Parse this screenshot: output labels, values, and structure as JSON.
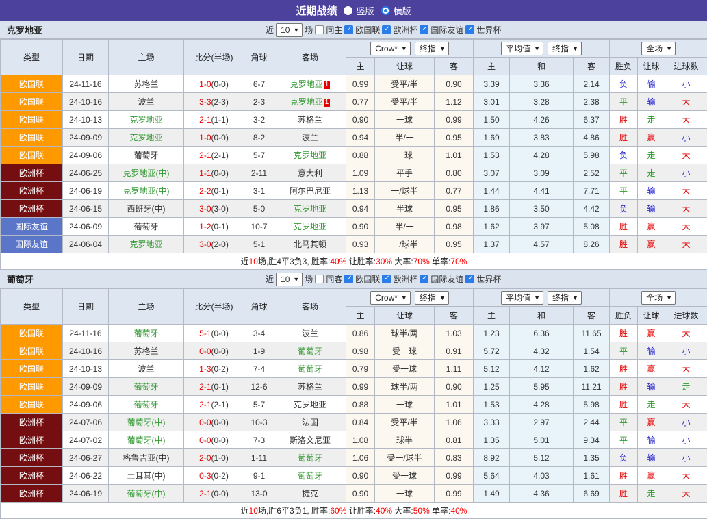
{
  "titlebar": {
    "title": "近期战绩",
    "radios": [
      {
        "label": "竖版",
        "selected": false
      },
      {
        "label": "横版",
        "selected": true
      }
    ]
  },
  "filter": {
    "near": "近",
    "count": "10",
    "field": "场",
    "comps": [
      "欧国联",
      "欧洲杯",
      "国际友谊",
      "世界杯"
    ]
  },
  "table": {
    "main_headers": [
      "类型",
      "日期",
      "主场",
      "比分(半场)",
      "角球",
      "客场"
    ],
    "dropdowns": {
      "source": "Crow*",
      "final_a": "终指",
      "average": "平均值",
      "final_b": "终指",
      "scope": "全场"
    },
    "sub_headers": [
      "主",
      "让球",
      "客",
      "主",
      "和",
      "客",
      "胜负",
      "让球",
      "进球数"
    ]
  },
  "colors": {
    "type_bg": {
      "欧国联": "#ff9900",
      "欧洲杯": "#740e11",
      "国际友谊": "#5b76c8"
    },
    "result": {
      "胜": "red",
      "平": "green",
      "负": "blue",
      "赢": "red",
      "走": "green",
      "输": "blue",
      "大": "red",
      "小": "blue"
    }
  },
  "sections": [
    {
      "team": "克罗地亚",
      "same_toggle": "同主",
      "rows": [
        {
          "type": "欧国联",
          "date": "24-11-16",
          "home": "苏格兰",
          "home_self": false,
          "score": "1-0",
          "half": "(0-0)",
          "corner": "6-7",
          "away": "克罗地亚",
          "away_self": true,
          "away_mark": "1",
          "odds": [
            "0.99",
            "受平/半",
            "0.90"
          ],
          "avg": [
            "3.39",
            "3.36",
            "2.14"
          ],
          "result": [
            "负",
            "输",
            "小"
          ]
        },
        {
          "type": "欧国联",
          "date": "24-10-16",
          "home": "波兰",
          "home_self": false,
          "score": "3-3",
          "half": "(2-3)",
          "corner": "2-3",
          "away": "克罗地亚",
          "away_self": true,
          "away_mark": "1",
          "odds": [
            "0.77",
            "受平/半",
            "1.12"
          ],
          "avg": [
            "3.01",
            "3.28",
            "2.38"
          ],
          "result": [
            "平",
            "输",
            "大"
          ]
        },
        {
          "type": "欧国联",
          "date": "24-10-13",
          "home": "克罗地亚",
          "home_self": true,
          "score": "2-1",
          "half": "(1-1)",
          "corner": "3-2",
          "away": "苏格兰",
          "away_self": false,
          "odds": [
            "0.90",
            "一球",
            "0.99"
          ],
          "avg": [
            "1.50",
            "4.26",
            "6.37"
          ],
          "result": [
            "胜",
            "走",
            "大"
          ]
        },
        {
          "type": "欧国联",
          "date": "24-09-09",
          "home": "克罗地亚",
          "home_self": true,
          "score": "1-0",
          "half": "(0-0)",
          "corner": "8-2",
          "away": "波兰",
          "away_self": false,
          "odds": [
            "0.94",
            "半/一",
            "0.95"
          ],
          "avg": [
            "1.69",
            "3.83",
            "4.86"
          ],
          "result": [
            "胜",
            "赢",
            "小"
          ]
        },
        {
          "type": "欧国联",
          "date": "24-09-06",
          "home": "葡萄牙",
          "home_self": false,
          "score": "2-1",
          "half": "(2-1)",
          "corner": "5-7",
          "away": "克罗地亚",
          "away_self": true,
          "odds": [
            "0.88",
            "一球",
            "1.01"
          ],
          "avg": [
            "1.53",
            "4.28",
            "5.98"
          ],
          "result": [
            "负",
            "走",
            "大"
          ]
        },
        {
          "type": "欧洲杯",
          "date": "24-06-25",
          "home": "克罗地亚(中)",
          "home_self": true,
          "score": "1-1",
          "half": "(0-0)",
          "corner": "2-11",
          "away": "意大利",
          "away_self": false,
          "odds": [
            "1.09",
            "平手",
            "0.80"
          ],
          "avg": [
            "3.07",
            "3.09",
            "2.52"
          ],
          "result": [
            "平",
            "走",
            "小"
          ]
        },
        {
          "type": "欧洲杯",
          "date": "24-06-19",
          "home": "克罗地亚(中)",
          "home_self": true,
          "score": "2-2",
          "half": "(0-1)",
          "corner": "3-1",
          "away": "阿尔巴尼亚",
          "away_self": false,
          "odds": [
            "1.13",
            "一/球半",
            "0.77"
          ],
          "avg": [
            "1.44",
            "4.41",
            "7.71"
          ],
          "result": [
            "平",
            "输",
            "大"
          ]
        },
        {
          "type": "欧洲杯",
          "date": "24-06-15",
          "home": "西班牙(中)",
          "home_self": false,
          "score": "3-0",
          "half": "(3-0)",
          "corner": "5-0",
          "away": "克罗地亚",
          "away_self": true,
          "odds": [
            "0.94",
            "半球",
            "0.95"
          ],
          "avg": [
            "1.86",
            "3.50",
            "4.42"
          ],
          "result": [
            "负",
            "输",
            "大"
          ]
        },
        {
          "type": "国际友谊",
          "date": "24-06-09",
          "home": "葡萄牙",
          "home_self": false,
          "score": "1-2",
          "half": "(0-1)",
          "corner": "10-7",
          "away": "克罗地亚",
          "away_self": true,
          "odds": [
            "0.90",
            "半/一",
            "0.98"
          ],
          "avg": [
            "1.62",
            "3.97",
            "5.08"
          ],
          "result": [
            "胜",
            "赢",
            "大"
          ]
        },
        {
          "type": "国际友谊",
          "date": "24-06-04",
          "home": "克罗地亚",
          "home_self": true,
          "score": "3-0",
          "half": "(2-0)",
          "corner": "5-1",
          "away": "北马其顿",
          "away_self": false,
          "odds": [
            "0.93",
            "一/球半",
            "0.95"
          ],
          "avg": [
            "1.37",
            "4.57",
            "8.26"
          ],
          "result": [
            "胜",
            "赢",
            "大"
          ]
        }
      ],
      "summary": [
        [
          "近",
          "k"
        ],
        [
          "10",
          "r"
        ],
        [
          "场,胜4平3负3, 胜率:",
          "k"
        ],
        [
          "40%",
          "r"
        ],
        [
          " 让胜率:",
          "k"
        ],
        [
          "30%",
          "r"
        ],
        [
          " 大率:",
          "k"
        ],
        [
          "70%",
          "r"
        ],
        [
          " 单率:",
          "k"
        ],
        [
          "70%",
          "r"
        ]
      ]
    },
    {
      "team": "葡萄牙",
      "same_toggle": "同客",
      "rows": [
        {
          "type": "欧国联",
          "date": "24-11-16",
          "home": "葡萄牙",
          "home_self": true,
          "score": "5-1",
          "half": "(0-0)",
          "corner": "3-4",
          "away": "波兰",
          "away_self": false,
          "odds": [
            "0.86",
            "球半/两",
            "1.03"
          ],
          "avg": [
            "1.23",
            "6.36",
            "11.65"
          ],
          "result": [
            "胜",
            "赢",
            "大"
          ]
        },
        {
          "type": "欧国联",
          "date": "24-10-16",
          "home": "苏格兰",
          "home_self": false,
          "score": "0-0",
          "half": "(0-0)",
          "corner": "1-9",
          "away": "葡萄牙",
          "away_self": true,
          "odds": [
            "0.98",
            "受一球",
            "0.91"
          ],
          "avg": [
            "5.72",
            "4.32",
            "1.54"
          ],
          "result": [
            "平",
            "输",
            "小"
          ]
        },
        {
          "type": "欧国联",
          "date": "24-10-13",
          "home": "波兰",
          "home_self": false,
          "score": "1-3",
          "half": "(0-2)",
          "corner": "7-4",
          "away": "葡萄牙",
          "away_self": true,
          "odds": [
            "0.79",
            "受一球",
            "1.11"
          ],
          "avg": [
            "5.12",
            "4.12",
            "1.62"
          ],
          "result": [
            "胜",
            "赢",
            "大"
          ]
        },
        {
          "type": "欧国联",
          "date": "24-09-09",
          "home": "葡萄牙",
          "home_self": true,
          "score": "2-1",
          "half": "(0-1)",
          "corner": "12-6",
          "away": "苏格兰",
          "away_self": false,
          "odds": [
            "0.99",
            "球半/两",
            "0.90"
          ],
          "avg": [
            "1.25",
            "5.95",
            "11.21"
          ],
          "result": [
            "胜",
            "输",
            "走"
          ]
        },
        {
          "type": "欧国联",
          "date": "24-09-06",
          "home": "葡萄牙",
          "home_self": true,
          "score": "2-1",
          "half": "(2-1)",
          "corner": "5-7",
          "away": "克罗地亚",
          "away_self": false,
          "odds": [
            "0.88",
            "一球",
            "1.01"
          ],
          "avg": [
            "1.53",
            "4.28",
            "5.98"
          ],
          "result": [
            "胜",
            "走",
            "大"
          ]
        },
        {
          "type": "欧洲杯",
          "date": "24-07-06",
          "home": "葡萄牙(中)",
          "home_self": true,
          "score": "0-0",
          "half": "(0-0)",
          "corner": "10-3",
          "away": "法国",
          "away_self": false,
          "odds": [
            "0.84",
            "受平/半",
            "1.06"
          ],
          "avg": [
            "3.33",
            "2.97",
            "2.44"
          ],
          "result": [
            "平",
            "赢",
            "小"
          ]
        },
        {
          "type": "欧洲杯",
          "date": "24-07-02",
          "home": "葡萄牙(中)",
          "home_self": true,
          "score": "0-0",
          "half": "(0-0)",
          "corner": "7-3",
          "away": "斯洛文尼亚",
          "away_self": false,
          "odds": [
            "1.08",
            "球半",
            "0.81"
          ],
          "avg": [
            "1.35",
            "5.01",
            "9.34"
          ],
          "result": [
            "平",
            "输",
            "小"
          ]
        },
        {
          "type": "欧洲杯",
          "date": "24-06-27",
          "home": "格鲁吉亚(中)",
          "home_self": false,
          "score": "2-0",
          "half": "(1-0)",
          "corner": "1-11",
          "away": "葡萄牙",
          "away_self": true,
          "odds": [
            "1.06",
            "受一/球半",
            "0.83"
          ],
          "avg": [
            "8.92",
            "5.12",
            "1.35"
          ],
          "result": [
            "负",
            "输",
            "小"
          ]
        },
        {
          "type": "欧洲杯",
          "date": "24-06-22",
          "home": "土耳其(中)",
          "home_self": false,
          "score": "0-3",
          "half": "(0-2)",
          "corner": "9-1",
          "away": "葡萄牙",
          "away_self": true,
          "odds": [
            "0.90",
            "受一球",
            "0.99"
          ],
          "avg": [
            "5.64",
            "4.03",
            "1.61"
          ],
          "result": [
            "胜",
            "赢",
            "大"
          ]
        },
        {
          "type": "欧洲杯",
          "date": "24-06-19",
          "home": "葡萄牙(中)",
          "home_self": true,
          "score": "2-1",
          "half": "(0-0)",
          "corner": "13-0",
          "away": "捷克",
          "away_self": false,
          "odds": [
            "0.90",
            "一球",
            "0.99"
          ],
          "avg": [
            "1.49",
            "4.36",
            "6.69"
          ],
          "result": [
            "胜",
            "走",
            "大"
          ]
        }
      ],
      "summary": [
        [
          "近",
          "k"
        ],
        [
          "10",
          "r"
        ],
        [
          "场,胜6平3负1, 胜率:",
          "k"
        ],
        [
          "60%",
          "r"
        ],
        [
          " 让胜率:",
          "k"
        ],
        [
          "40%",
          "r"
        ],
        [
          " 大率:",
          "k"
        ],
        [
          "50%",
          "r"
        ],
        [
          " 单率:",
          "k"
        ],
        [
          "40%",
          "r"
        ]
      ]
    }
  ]
}
